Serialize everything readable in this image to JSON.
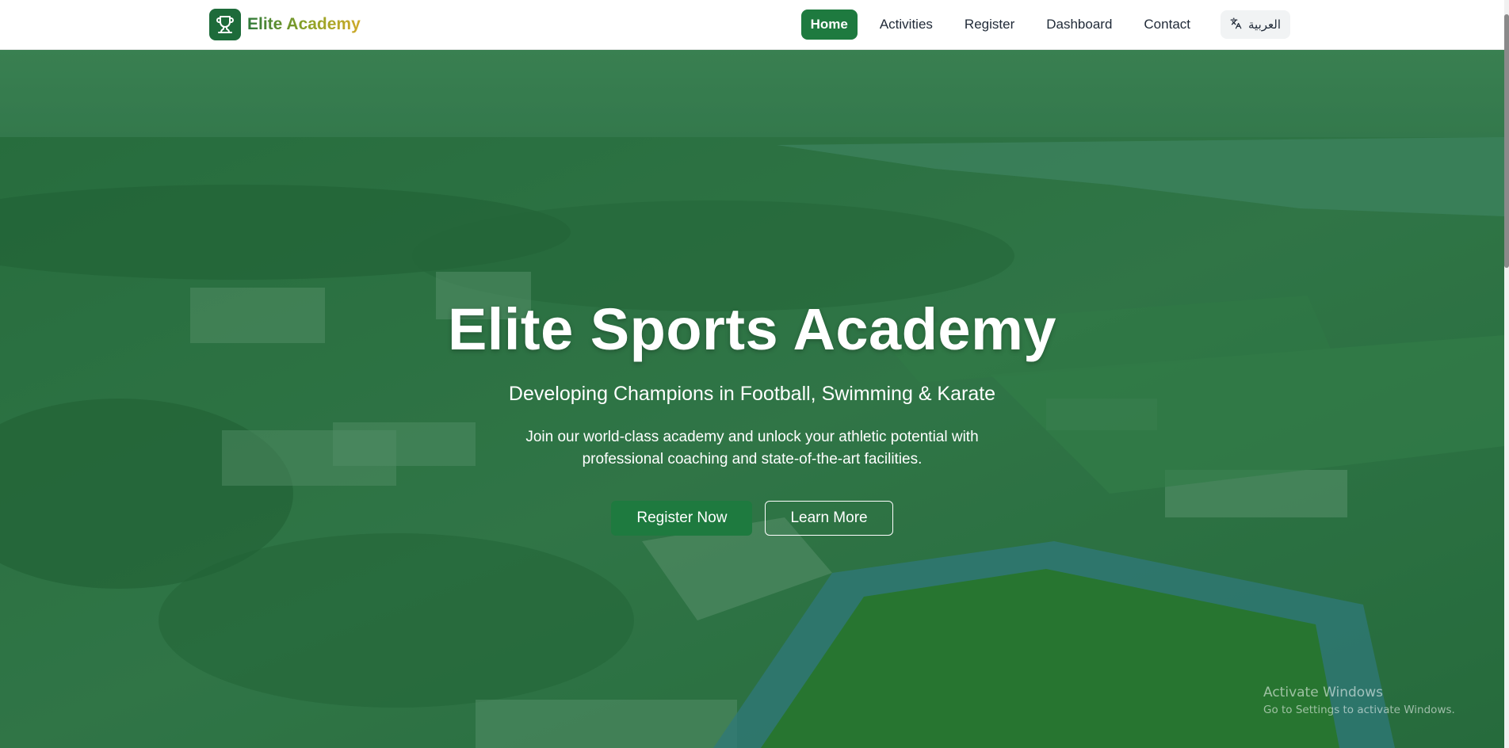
{
  "brand": {
    "name": "Elite Academy",
    "logo_icon": "trophy-icon"
  },
  "nav": {
    "items": [
      {
        "label": "Home",
        "active": true
      },
      {
        "label": "Activities",
        "active": false
      },
      {
        "label": "Register",
        "active": false
      },
      {
        "label": "Dashboard",
        "active": false
      },
      {
        "label": "Contact",
        "active": false
      }
    ],
    "language": {
      "label": "العربية",
      "icon": "translate-icon"
    }
  },
  "hero": {
    "title": "Elite Sports Academy",
    "subtitle": "Developing Champions in Football, Swimming & Karate",
    "description": "Join our world-class academy and unlock your athletic potential with professional coaching and state-of-the-art facilities.",
    "primary_button": "Register Now",
    "secondary_button": "Learn More",
    "background": "aerial-sports-complex-photo"
  },
  "watermark": {
    "title": "Activate Windows",
    "subtitle": "Go to Settings to activate Windows."
  },
  "colors": {
    "primary": "#1e7a3f",
    "brand_dark": "#1d6b3a",
    "brand_gold": "#cfa92a",
    "nav_text": "#1f2937"
  }
}
